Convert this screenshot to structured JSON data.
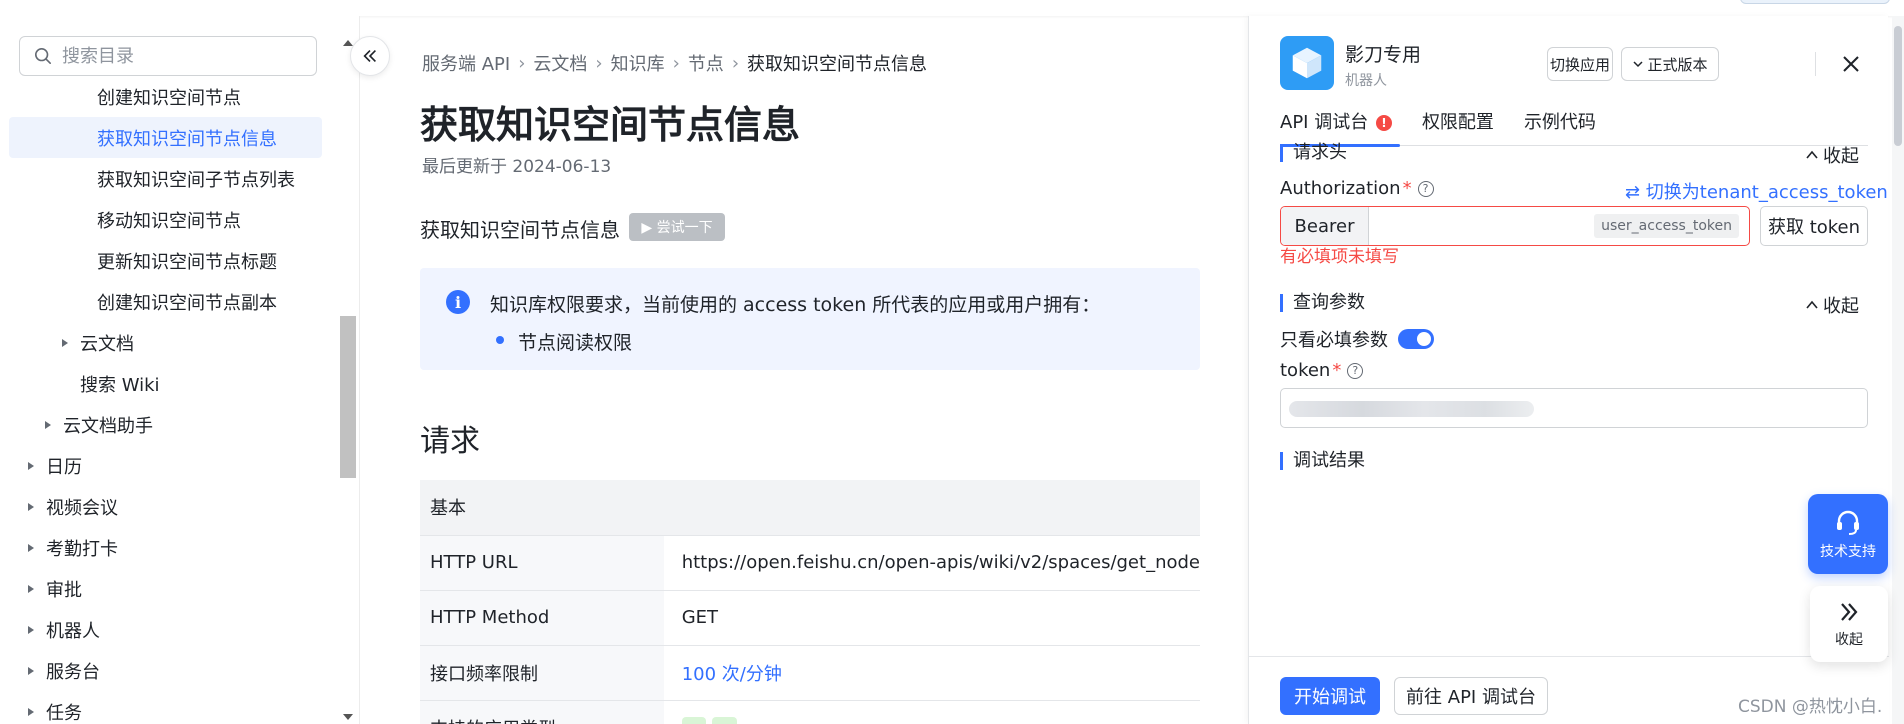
{
  "sidebar": {
    "search_placeholder": "搜索目录",
    "items": [
      {
        "label": "创建知识空间节点",
        "indent": 3,
        "caret": false,
        "active": false
      },
      {
        "label": "获取知识空间节点信息",
        "indent": 3,
        "caret": false,
        "active": true
      },
      {
        "label": "获取知识空间子节点列表",
        "indent": 3,
        "caret": false,
        "active": false
      },
      {
        "label": "移动知识空间节点",
        "indent": 3,
        "caret": false,
        "active": false
      },
      {
        "label": "更新知识空间节点标题",
        "indent": 3,
        "caret": false,
        "active": false
      },
      {
        "label": "创建知识空间节点副本",
        "indent": 3,
        "caret": false,
        "active": false
      },
      {
        "label": "云文档",
        "indent": 2,
        "caret": true,
        "active": false
      },
      {
        "label": "搜索 Wiki",
        "indent": 2,
        "caret": false,
        "active": false
      },
      {
        "label": "云文档助手",
        "indent": 1,
        "caret": true,
        "active": false
      },
      {
        "label": "日历",
        "indent": 0,
        "caret": true,
        "active": false
      },
      {
        "label": "视频会议",
        "indent": 0,
        "caret": true,
        "active": false
      },
      {
        "label": "考勤打卡",
        "indent": 0,
        "caret": true,
        "active": false
      },
      {
        "label": "审批",
        "indent": 0,
        "caret": true,
        "active": false
      },
      {
        "label": "机器人",
        "indent": 0,
        "caret": true,
        "active": false
      },
      {
        "label": "服务台",
        "indent": 0,
        "caret": true,
        "active": false
      },
      {
        "label": "任务",
        "indent": 0,
        "caret": true,
        "active": false
      }
    ]
  },
  "main": {
    "breadcrumb": [
      "服务端 API",
      "云文档",
      "知识库",
      "节点",
      "获取知识空间节点信息"
    ],
    "title": "获取知识空间节点信息",
    "updated": "最后更新于 2024-06-13",
    "subtitle": "获取知识空间节点信息",
    "try_label": "▶ 尝试一下",
    "notice_text": "知识库权限要求，当前使用的 access token 所代表的应用或用户拥有：",
    "notice_bullet": "节点阅读权限",
    "request_heading": "请求",
    "table": {
      "header": "基本",
      "rows": [
        {
          "key": "HTTP URL",
          "value": "https://open.feishu.cn/open-apis/wiki/v2/spaces/get_node",
          "link": false
        },
        {
          "key": "HTTP Method",
          "value": "GET",
          "link": false
        },
        {
          "key": "接口频率限制",
          "value": "100 次/分钟",
          "link": true
        }
      ],
      "partial_row_key": "支持的应用类型"
    }
  },
  "panel": {
    "app_name": "影刀专用",
    "app_type": "机器人",
    "switch_app": "切换应用",
    "version": "正式版本",
    "tabs": [
      "API 调试台",
      "权限配置",
      "示例代码"
    ],
    "alert_mark": "!",
    "headers_section": "请求头",
    "fold_label": "收起",
    "auth_label": "Authorization",
    "required_mark": "*",
    "help_mark": "?",
    "switch_token": "⇄ 切换为tenant_access_token",
    "bearer": "Bearer",
    "auth_value": "",
    "token_tag": "user_access_token",
    "get_token": "获取 token",
    "error": "有必填项未填写",
    "query_section": "查询参数",
    "required_only": "只看必填参数",
    "token_label": "token",
    "result_section": "调试结果",
    "start_debug": "开始调试",
    "goto_console": "前往 API 调试台"
  },
  "floating": {
    "support": "技术支持",
    "fold": "收起"
  },
  "watermark": "CSDN @热忱小白.",
  "colors": {
    "accent": "#3370ff",
    "error": "#f54a45",
    "app_icon": "#2e9cf5"
  }
}
